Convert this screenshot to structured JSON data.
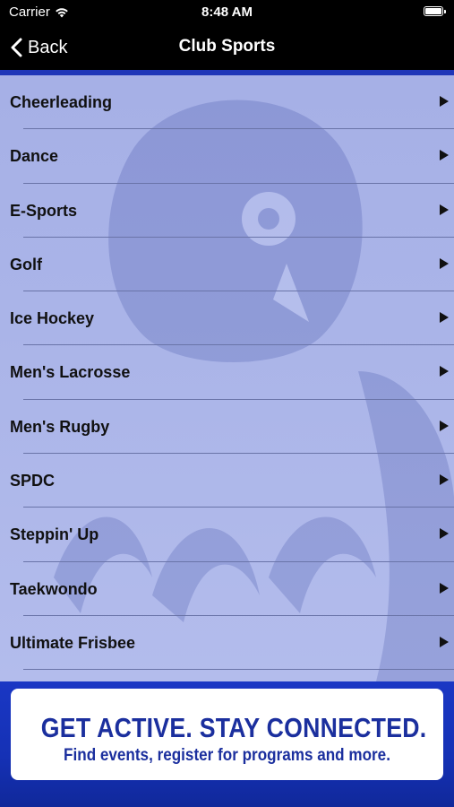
{
  "status_bar": {
    "carrier": "Carrier",
    "time": "8:48 AM",
    "battery_level": 1.0
  },
  "nav": {
    "back_label": "Back",
    "title": "Club Sports"
  },
  "club_sports": [
    {
      "label": "Cheerleading"
    },
    {
      "label": "Dance"
    },
    {
      "label": "E-Sports"
    },
    {
      "label": "Golf"
    },
    {
      "label": "Ice Hockey"
    },
    {
      "label": "Men's Lacrosse"
    },
    {
      "label": "Men's Rugby"
    },
    {
      "label": "SPDC"
    },
    {
      "label": "Steppin' Up"
    },
    {
      "label": "Taekwondo"
    },
    {
      "label": "Ultimate Frisbee"
    }
  ],
  "banner": {
    "headline": "GET ACTIVE.  STAY CONNECTED.",
    "subline": "Find events, register for programs and more."
  },
  "colors": {
    "accent": "#1f36b8",
    "list_bg": "#a6b0e6",
    "banner_text": "#1b2f9e"
  }
}
